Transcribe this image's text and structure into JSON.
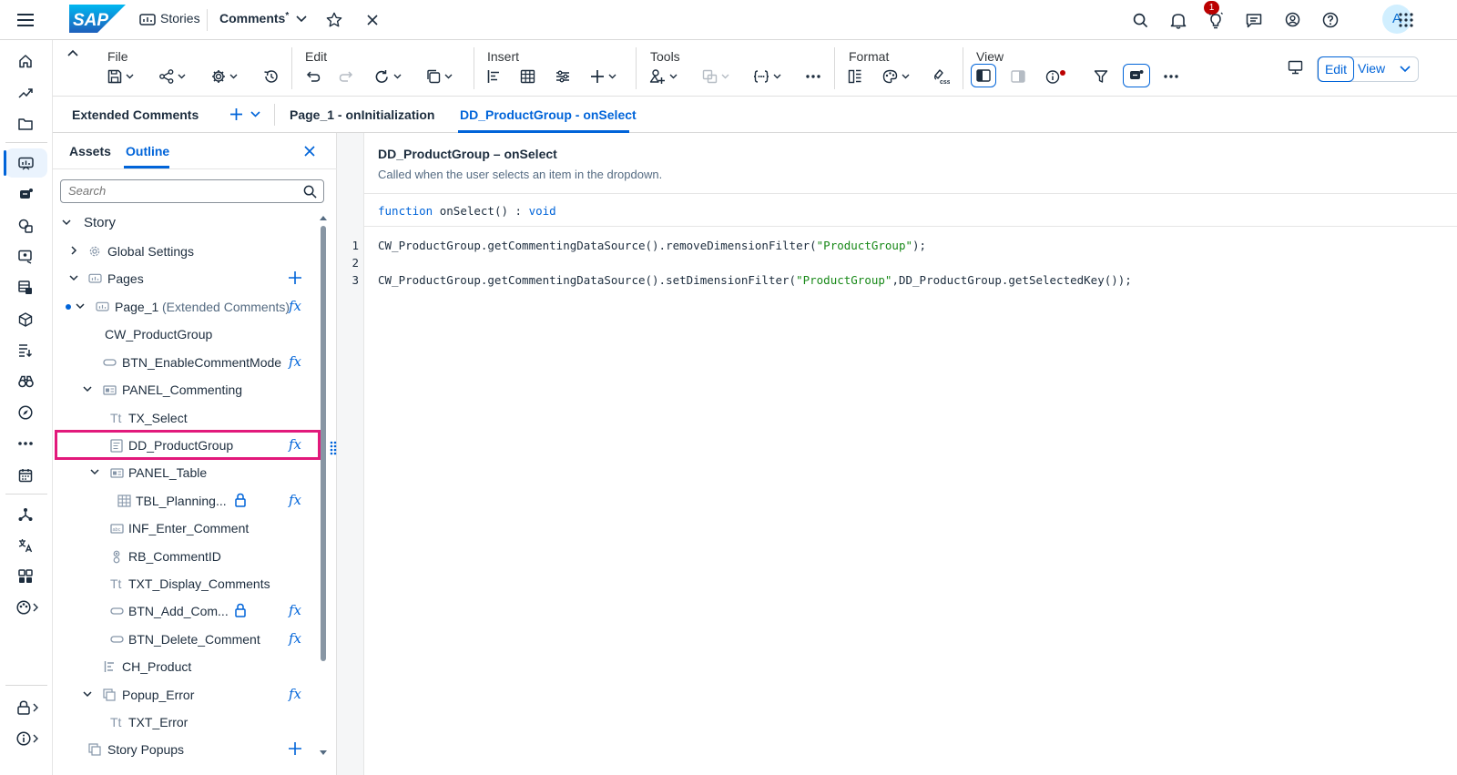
{
  "shell": {
    "logo_text": "SAP",
    "breadcrumb_stories": "Stories",
    "doc_title": "Comments",
    "doc_modified_marker": "*",
    "notification_count": "1",
    "avatar_initial": "A"
  },
  "toolbar": {
    "groups": {
      "file": "File",
      "edit": "Edit",
      "insert": "Insert",
      "tools": "Tools",
      "format": "Format",
      "view": "View"
    },
    "edit_button": "Edit",
    "view_button": "View"
  },
  "tabs": {
    "extended_comments": "Extended Comments",
    "page_init": "Page_1 - onInitialization",
    "dd_select": "DD_ProductGroup - onSelect"
  },
  "outline": {
    "tab_assets": "Assets",
    "tab_outline": "Outline",
    "search_placeholder": "Search",
    "items": {
      "story": "Story",
      "global_settings": "Global Settings",
      "pages": "Pages",
      "page1": "Page_1",
      "page1_sub": "(Extended Comments)",
      "cw_productgroup": "CW_ProductGroup",
      "btn_enable": "BTN_EnableCommentMode",
      "panel_commenting": "PANEL_Commenting",
      "tx_select": "TX_Select",
      "dd_productgroup": "DD_ProductGroup",
      "panel_table": "PANEL_Table",
      "tbl_planning": "TBL_Planning...",
      "inf_enter": "INF_Enter_Comment",
      "rb_commentid": "RB_CommentID",
      "txt_display": "TXT_Display_Comments",
      "btn_add": "BTN_Add_Com...",
      "btn_delete": "BTN_Delete_Comment",
      "ch_product": "CH_Product",
      "popup_error": "Popup_Error",
      "txt_error": "TXT_Error",
      "story_popups": "Story Popups"
    },
    "icon_tt": "Tt"
  },
  "editor": {
    "title": "DD_ProductGroup – onSelect",
    "description": "Called when the user selects an item in the dropdown.",
    "signature": {
      "keyword": "function",
      "name": " onSelect() : ",
      "return_type": "void"
    },
    "lines": [
      {
        "no": "1",
        "pre": "CW_ProductGroup.getCommentingDataSource().removeDimensionFilter(",
        "str": "\"ProductGroup\"",
        "post": ");"
      },
      {
        "no": "2",
        "pre": "",
        "str": "",
        "post": ""
      },
      {
        "no": "3",
        "pre": "CW_ProductGroup.getCommentingDataSource().setDimensionFilter(",
        "str": "\"ProductGroup\"",
        "post": ",DD_ProductGroup.getSelectedKey());"
      }
    ]
  },
  "colors": {
    "accent": "#0064d9",
    "highlight": "#e2197b",
    "badge": "#bb0000",
    "string": "#188918"
  }
}
